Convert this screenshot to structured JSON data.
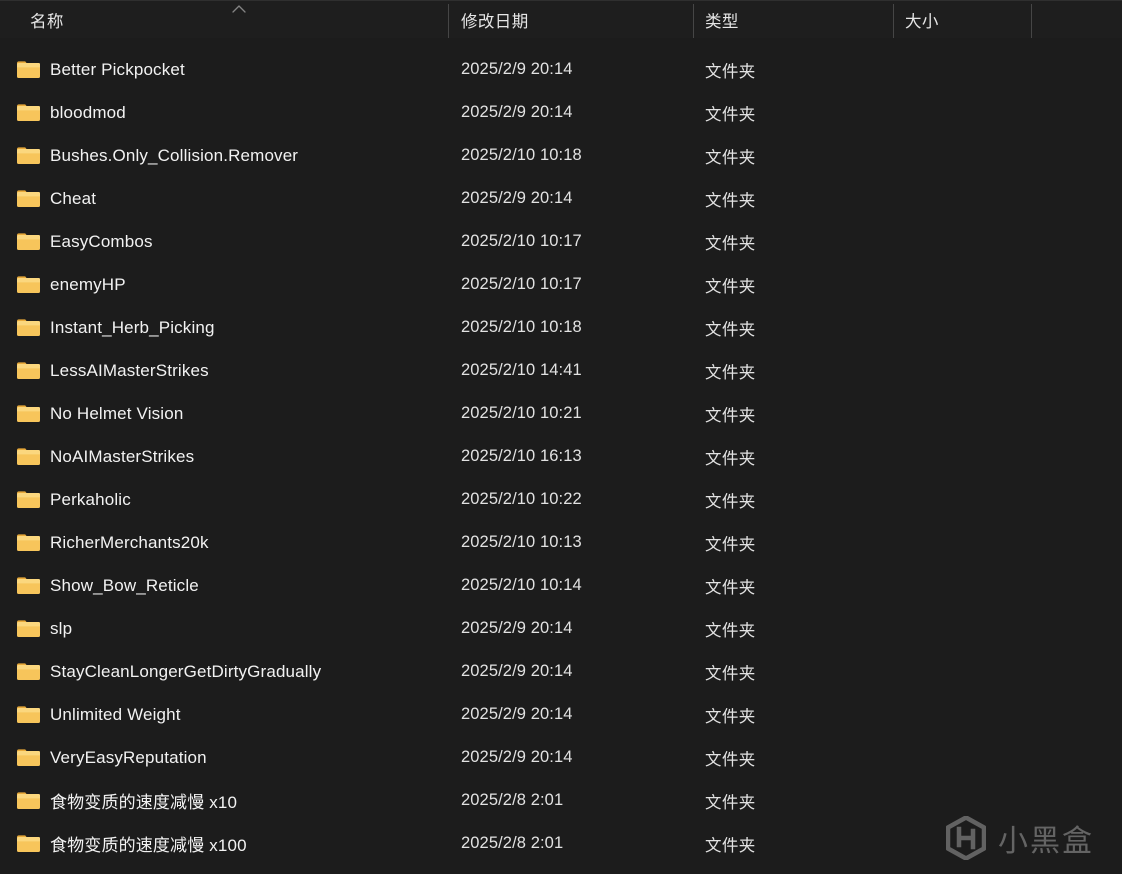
{
  "window": {
    "background_color": "#1c1c1c",
    "accent_folder_color": "#f7c55b"
  },
  "columns": {
    "name": "名称",
    "date_modified": "修改日期",
    "type": "类型",
    "size": "大小",
    "extra": "",
    "sort_icon": "chevron-up-icon",
    "sort_column": "名称",
    "sort_direction": "ascending"
  },
  "files": [
    {
      "icon": "folder-icon",
      "name": "Better Pickpocket",
      "date": "2025/2/9 20:14",
      "type": "文件夹",
      "size": ""
    },
    {
      "icon": "folder-icon",
      "name": "bloodmod",
      "date": "2025/2/9 20:14",
      "type": "文件夹",
      "size": ""
    },
    {
      "icon": "folder-icon",
      "name": "Bushes.Only_Collision.Remover",
      "date": "2025/2/10 10:18",
      "type": "文件夹",
      "size": ""
    },
    {
      "icon": "folder-icon",
      "name": "Cheat",
      "date": "2025/2/9 20:14",
      "type": "文件夹",
      "size": ""
    },
    {
      "icon": "folder-icon",
      "name": "EasyCombos",
      "date": "2025/2/10 10:17",
      "type": "文件夹",
      "size": ""
    },
    {
      "icon": "folder-icon",
      "name": "enemyHP",
      "date": "2025/2/10 10:17",
      "type": "文件夹",
      "size": ""
    },
    {
      "icon": "folder-icon",
      "name": "Instant_Herb_Picking",
      "date": "2025/2/10 10:18",
      "type": "文件夹",
      "size": ""
    },
    {
      "icon": "folder-icon",
      "name": "LessAIMasterStrikes",
      "date": "2025/2/10 14:41",
      "type": "文件夹",
      "size": ""
    },
    {
      "icon": "folder-icon",
      "name": "No Helmet Vision",
      "date": "2025/2/10 10:21",
      "type": "文件夹",
      "size": ""
    },
    {
      "icon": "folder-icon",
      "name": "NoAIMasterStrikes",
      "date": "2025/2/10 16:13",
      "type": "文件夹",
      "size": ""
    },
    {
      "icon": "folder-icon",
      "name": "Perkaholic",
      "date": "2025/2/10 10:22",
      "type": "文件夹",
      "size": ""
    },
    {
      "icon": "folder-icon",
      "name": "RicherMerchants20k",
      "date": "2025/2/10 10:13",
      "type": "文件夹",
      "size": ""
    },
    {
      "icon": "folder-icon",
      "name": "Show_Bow_Reticle",
      "date": "2025/2/10 10:14",
      "type": "文件夹",
      "size": ""
    },
    {
      "icon": "folder-icon",
      "name": "slp",
      "date": "2025/2/9 20:14",
      "type": "文件夹",
      "size": ""
    },
    {
      "icon": "folder-icon",
      "name": "StayCleanLongerGetDirtyGradually",
      "date": "2025/2/9 20:14",
      "type": "文件夹",
      "size": ""
    },
    {
      "icon": "folder-icon",
      "name": "Unlimited Weight",
      "date": "2025/2/9 20:14",
      "type": "文件夹",
      "size": ""
    },
    {
      "icon": "folder-icon",
      "name": "VeryEasyReputation",
      "date": "2025/2/9 20:14",
      "type": "文件夹",
      "size": ""
    },
    {
      "icon": "folder-icon",
      "name": "食物变质的速度减慢  x10",
      "date": "2025/2/8 2:01",
      "type": "文件夹",
      "size": ""
    },
    {
      "icon": "folder-icon",
      "name": "食物变质的速度减慢  x100",
      "date": "2025/2/8 2:01",
      "type": "文件夹",
      "size": ""
    }
  ],
  "watermark": {
    "text": "小黑盒",
    "logo_icon": "hexagon-h-logo-icon"
  }
}
